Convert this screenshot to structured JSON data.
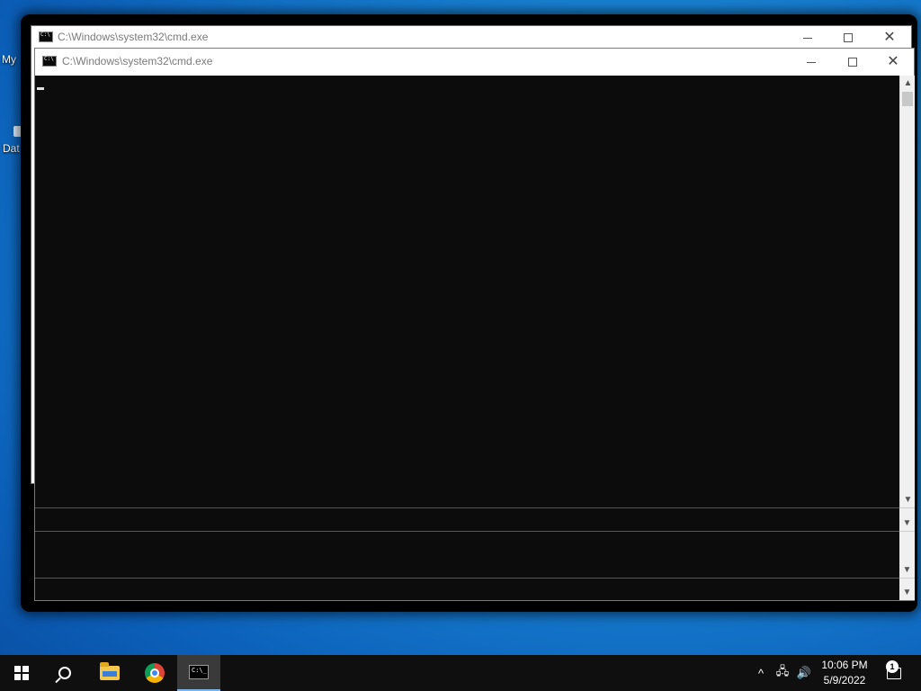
{
  "desktop": {
    "icons": [
      {
        "label": "My"
      },
      {
        "label": "Dat"
      }
    ]
  },
  "windows": {
    "back": {
      "title": "C:\\Windows\\system32\\cmd.exe"
    },
    "front": {
      "title": "C:\\Windows\\system32\\cmd.exe"
    }
  },
  "window_controls": {
    "minimize": "—",
    "maximize": "☐",
    "close": "✕"
  },
  "taskbar": {
    "start_icon": "windows-logo-icon",
    "search_icon": "search-icon",
    "pinned": [
      "file-explorer-icon",
      "chrome-icon",
      "command-prompt-icon"
    ],
    "tray": {
      "chevron": "^",
      "network_icon": "network-icon",
      "volume_icon": "volume-icon",
      "time": "10:06 PM",
      "date": "5/9/2022",
      "notification_count": "1"
    }
  }
}
